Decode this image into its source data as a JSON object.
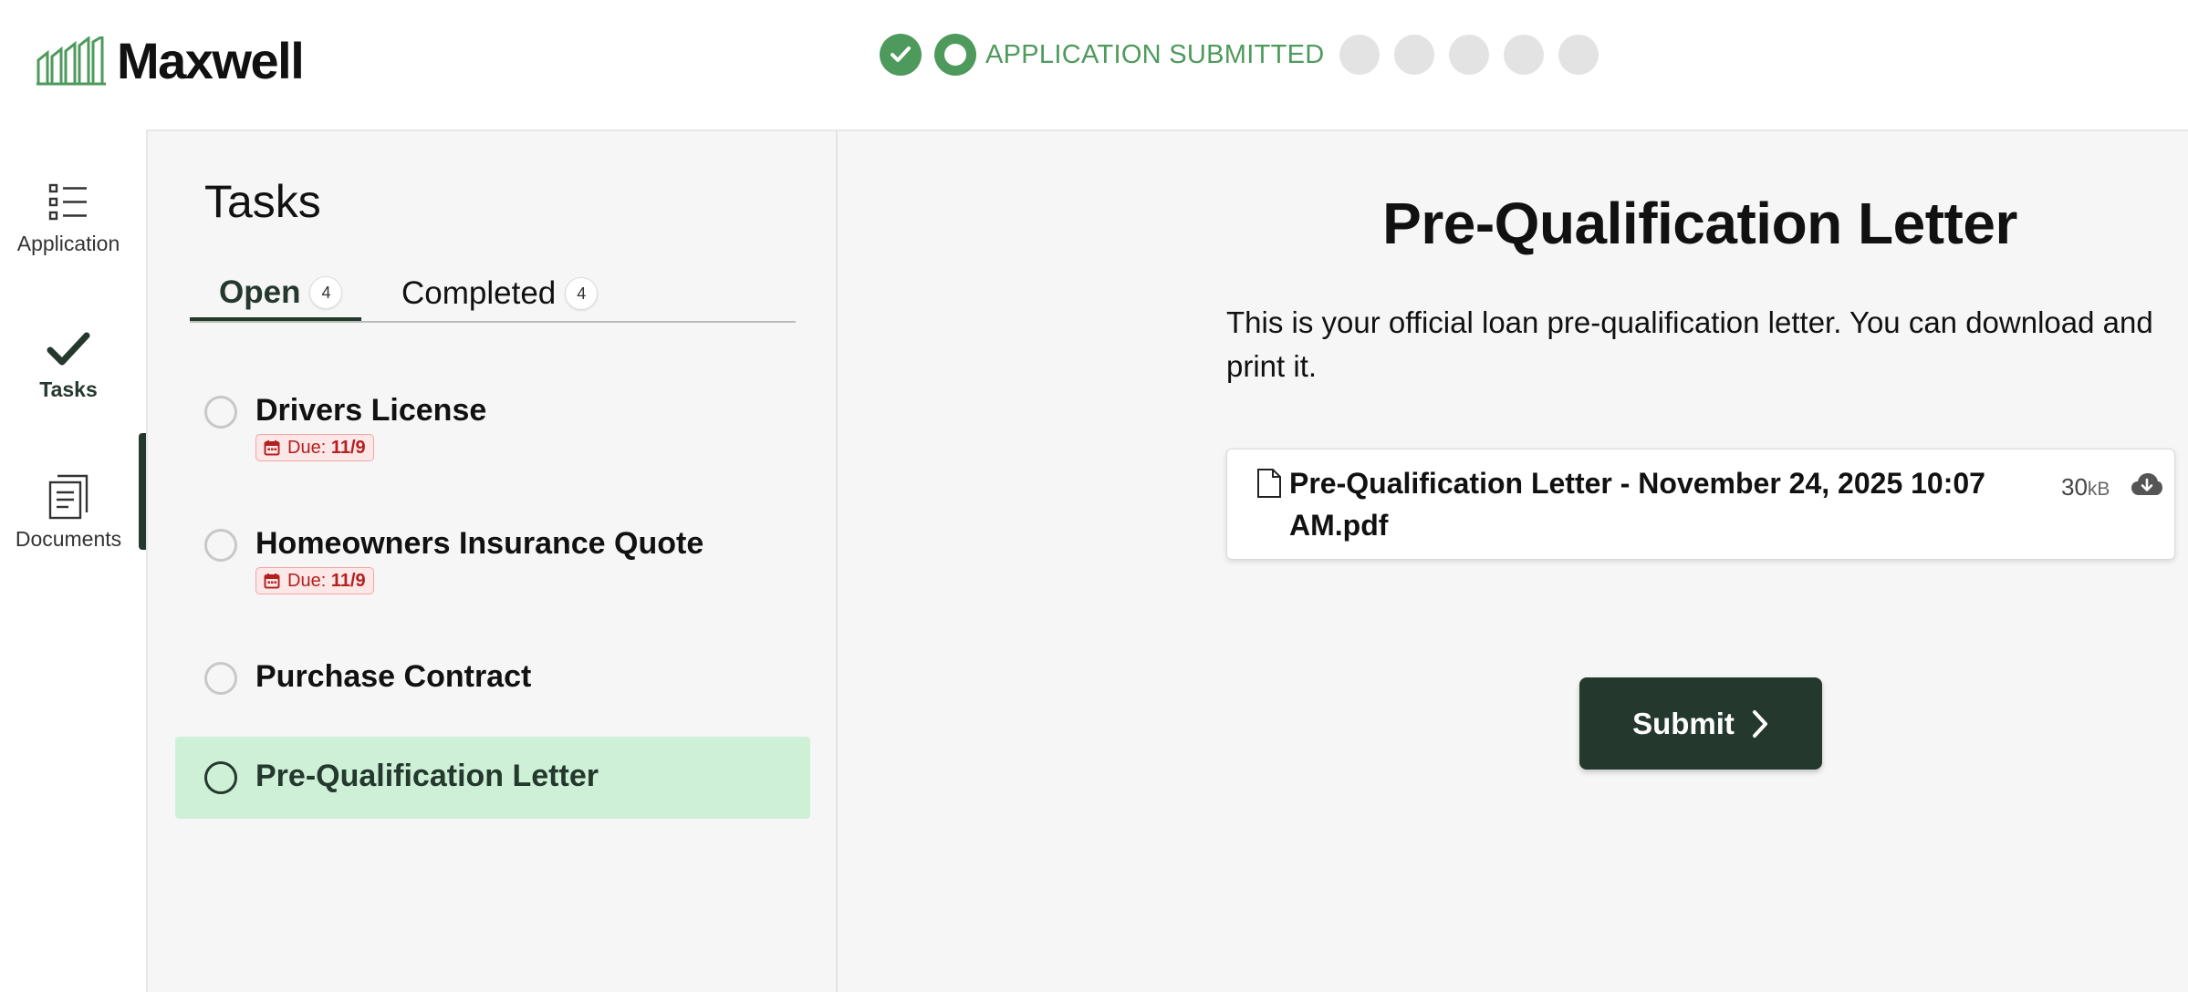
{
  "brand": {
    "name": "Maxwell"
  },
  "progress": {
    "current_step_label": "APPLICATION SUBMITTED",
    "future_step_count": 5,
    "accent_color": "#4e9a5c"
  },
  "sidenav": {
    "items": [
      {
        "label": "Application",
        "icon": "list-icon"
      },
      {
        "label": "Tasks",
        "icon": "checkmark-icon",
        "active": true
      },
      {
        "label": "Documents",
        "icon": "document-icon"
      }
    ]
  },
  "tasks": {
    "title": "Tasks",
    "tabs": [
      {
        "label": "Open",
        "count": "4",
        "active": true
      },
      {
        "label": "Completed",
        "count": "4"
      }
    ],
    "items": [
      {
        "title": "Drivers License",
        "due_prefix": "Due: ",
        "due_date": "11/9"
      },
      {
        "title": "Homeowners Insurance Quote",
        "due_prefix": "Due: ",
        "due_date": "11/9"
      },
      {
        "title": "Purchase Contract"
      },
      {
        "title": "Pre-Qualification Letter",
        "selected": true
      }
    ]
  },
  "detail": {
    "title": "Pre-Qualification Letter",
    "description": "This is your official loan pre-qualification letter. You can download and print it.",
    "file": {
      "name": "Pre-Qualification Letter - November 24, 2025 10:07 AM.pdf",
      "size": "30",
      "size_unit": "kB"
    },
    "submit_label": "Submit"
  },
  "colors": {
    "primary_dark": "#24382d",
    "accent_green": "#4e9a5c",
    "selected_row": "#cdf0d7",
    "due_text": "#b32020"
  }
}
